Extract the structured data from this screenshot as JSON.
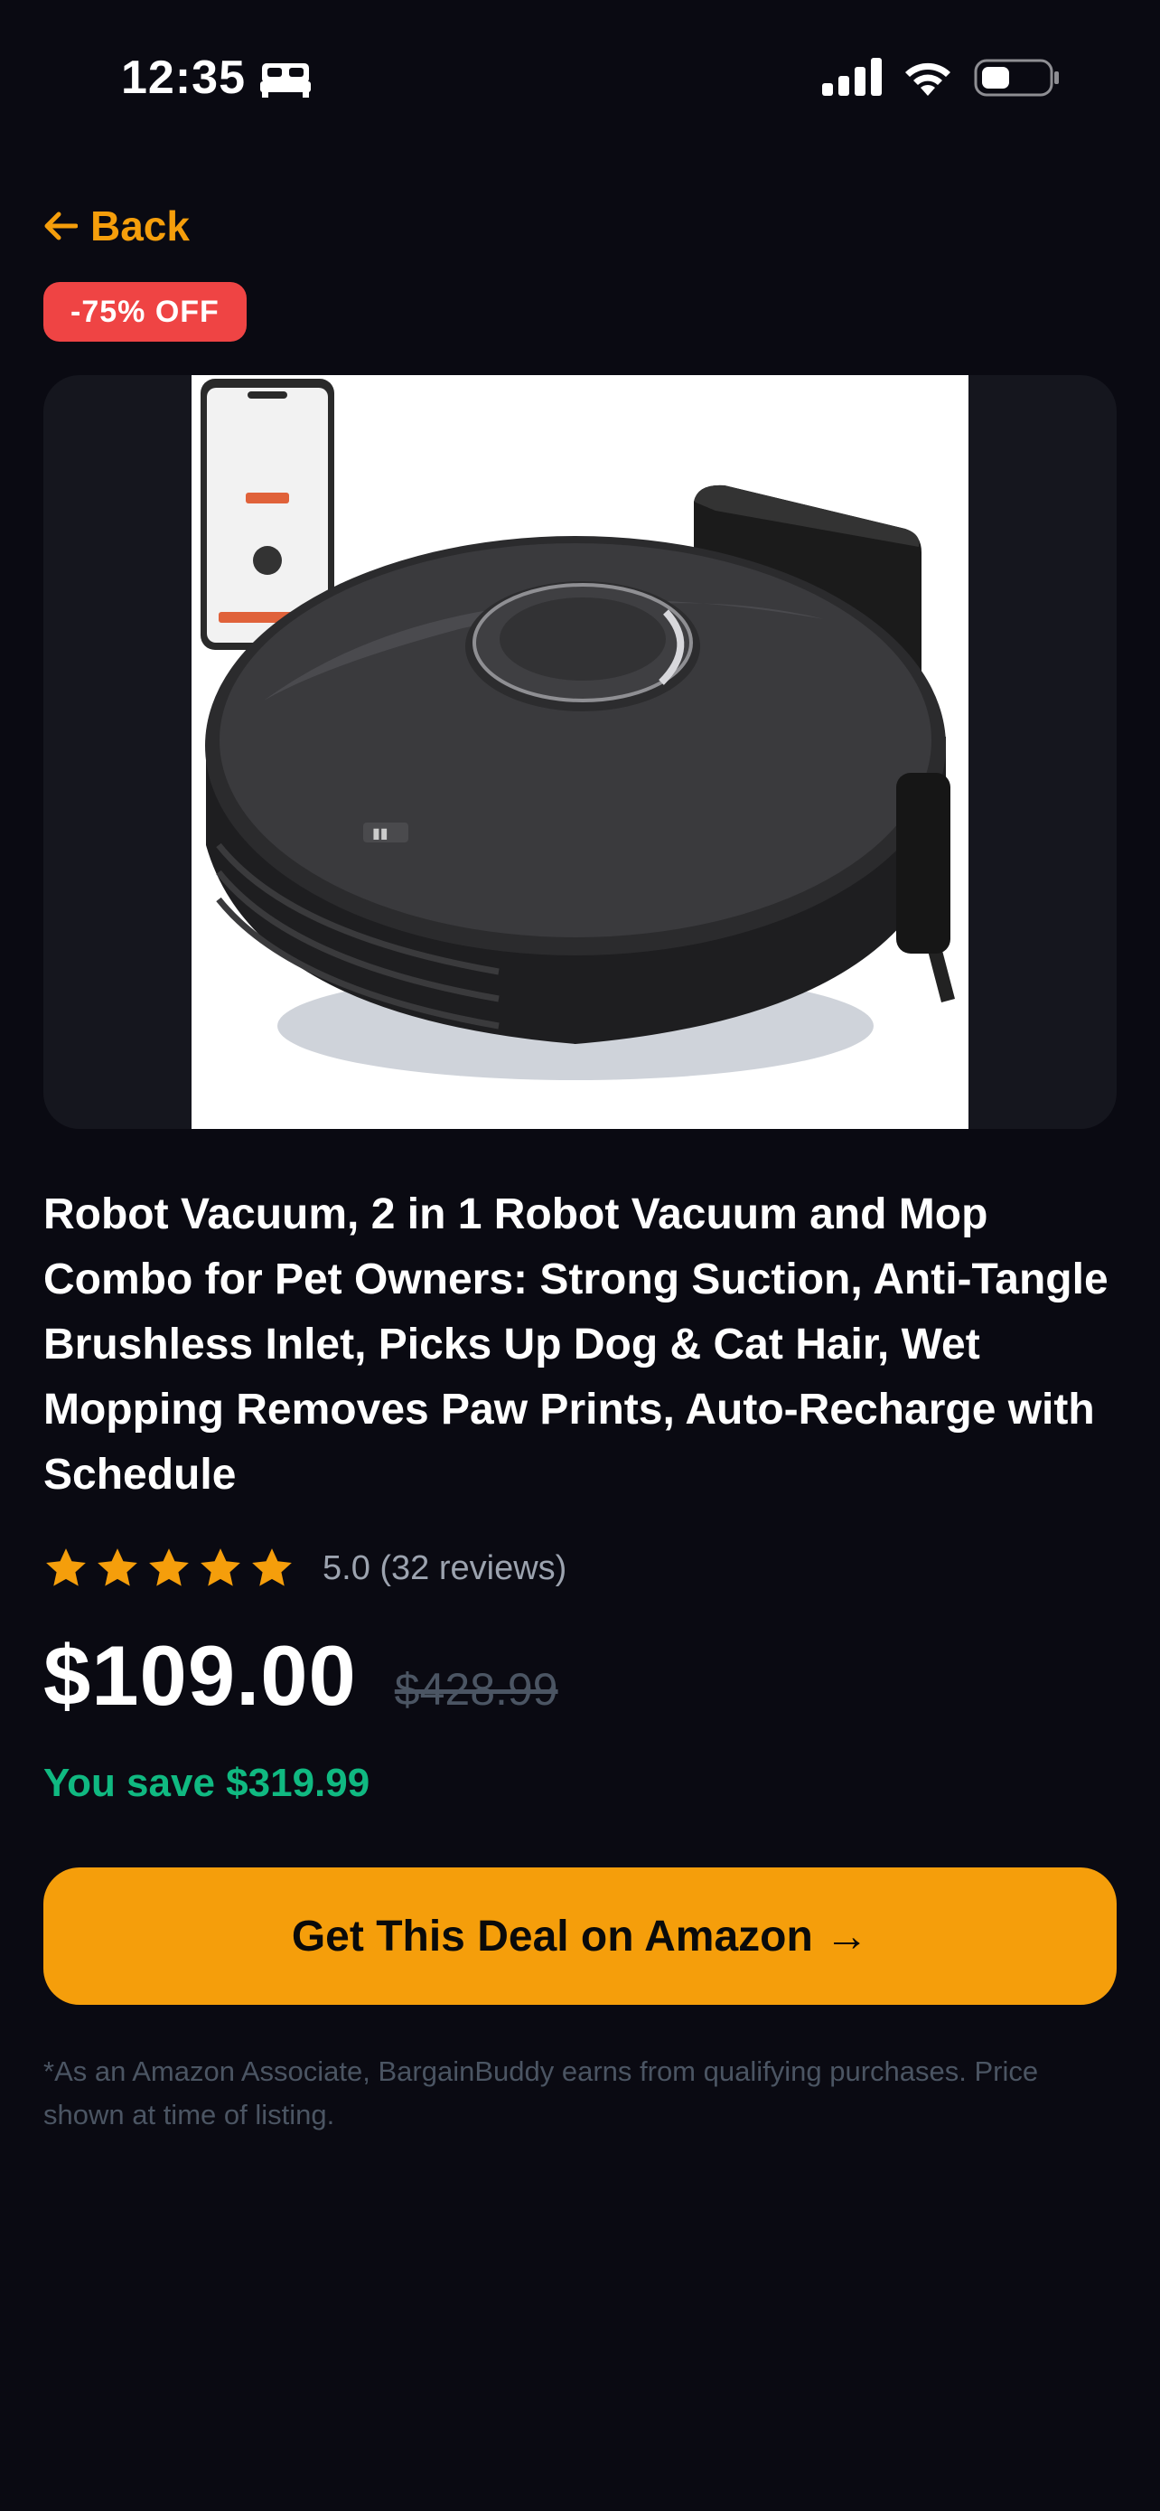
{
  "status_bar": {
    "time": "12:35",
    "icons": [
      "bed-icon",
      "signal-icon",
      "wifi-icon",
      "battery-icon"
    ]
  },
  "nav": {
    "back_label": "Back",
    "back_icon": "arrow-left-icon"
  },
  "product": {
    "discount_badge": "-75% OFF",
    "image_icon": "robot-vacuum-image",
    "title": "Robot Vacuum, 2 in 1 Robot Vacuum and Mop Combo for Pet Owners: Strong Suction, Anti-Tangle Brushless Inlet, Picks Up Dog & Cat Hair, Wet Mopping Removes Paw Prints, Auto-Recharge with Schedule",
    "rating": 5,
    "rating_text": "5.0 (32 reviews)",
    "price": "$109.00",
    "original_price": "$428.99",
    "savings": "You save $319.99"
  },
  "cta": {
    "label": "Get This Deal on Amazon →"
  },
  "disclaimer": "*As an Amazon Associate, BargainBuddy earns from qualifying purchases. Price shown at time of listing.",
  "colors": {
    "background": "#0a0a12",
    "accent": "#f59e0b",
    "badge": "#ef4444",
    "savings": "#10b981",
    "card": "#15161e"
  }
}
